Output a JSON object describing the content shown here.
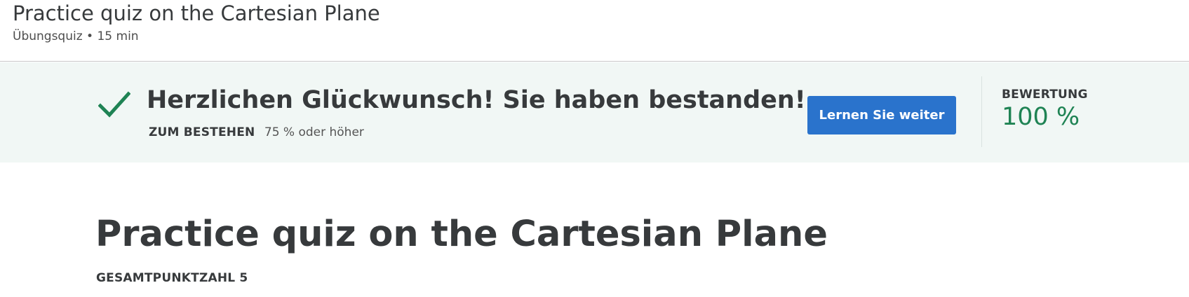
{
  "header": {
    "title": "Practice quiz on the Cartesian Plane",
    "subtitle": "Übungsquiz • 15 min"
  },
  "banner": {
    "icon": "checkmark-icon",
    "headline": "Herzlichen Glückwunsch! Sie haben bestanden!",
    "pass_label": "ZUM BESTEHEN",
    "pass_value": "75 % oder höher",
    "continue_label": "Lernen Sie weiter",
    "grade_label": "BEWERTUNG",
    "grade_value": "100 %",
    "colors": {
      "background": "#f1f7f5",
      "success": "#1f8354",
      "button": "#2a73cc"
    }
  },
  "main": {
    "title": "Practice quiz on the Cartesian Plane",
    "points_label": "GESAMTPUNKTZAHL 5"
  }
}
